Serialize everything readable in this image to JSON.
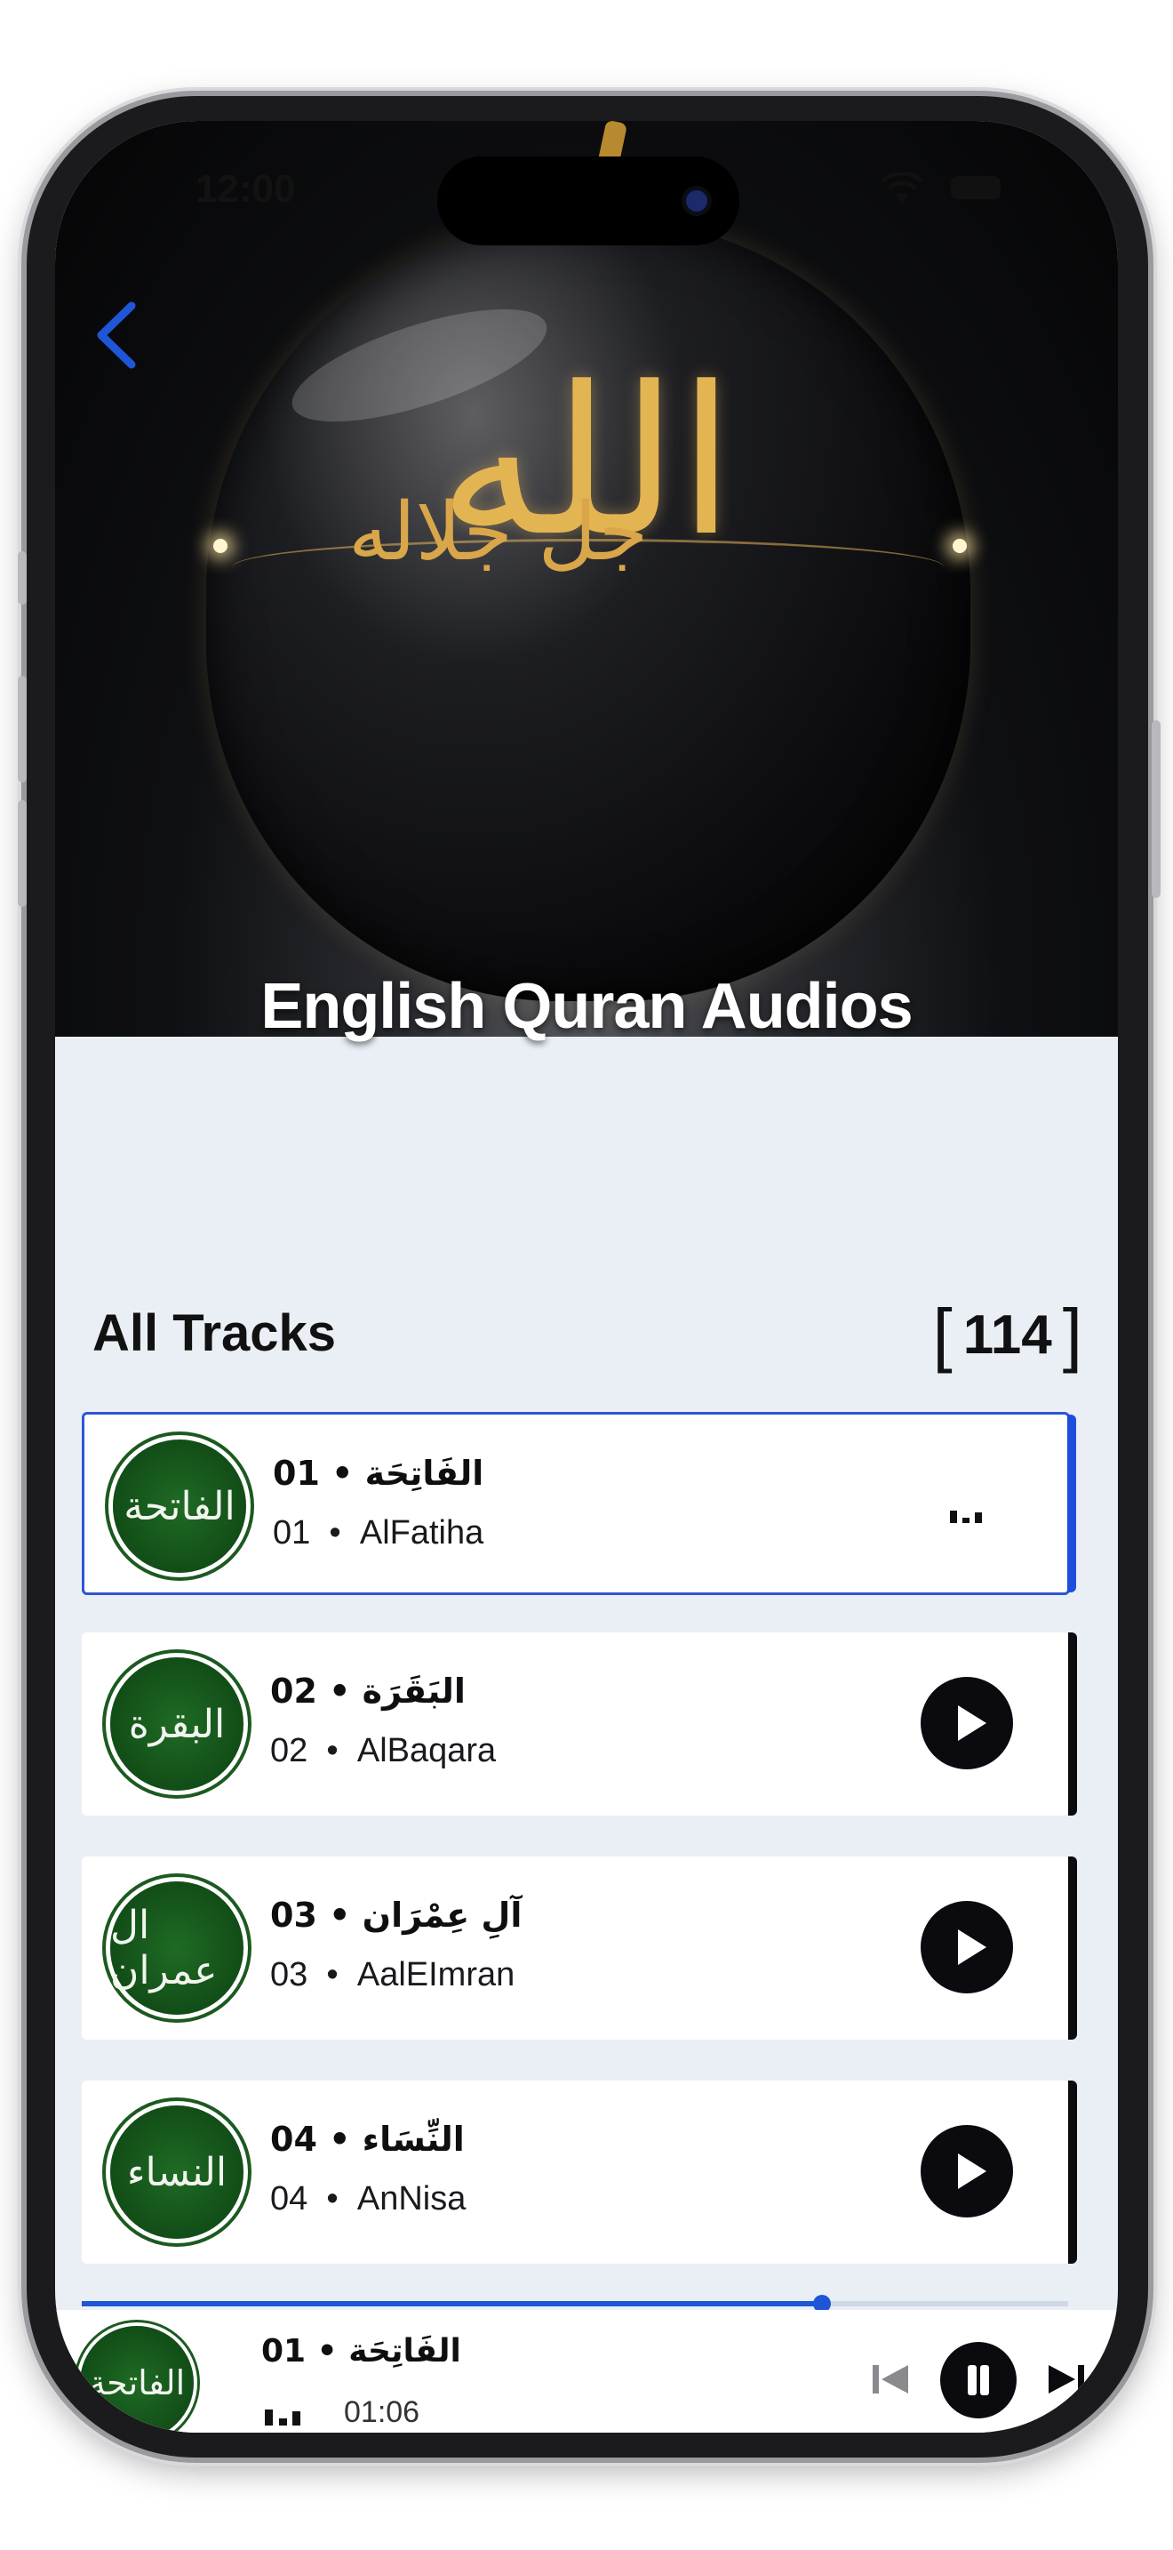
{
  "status_bar": {
    "time": "12:00"
  },
  "header": {
    "title": "English Quran Audios",
    "hero_calligraphy": "الله",
    "hero_calligraphy_2": "جل جلاله"
  },
  "tracks_section": {
    "title": "All Tracks",
    "count": "114"
  },
  "tracks": [
    {
      "arabic": "الفَاتِحَة",
      "number_bold": "01",
      "number": "01",
      "name": "AlFatiha",
      "badge_text": "الفاتحة",
      "state": "playing"
    },
    {
      "arabic": "البَقَرَة",
      "number_bold": "02",
      "number": "02",
      "name": "AlBaqara",
      "badge_text": "البقرة",
      "state": "idle"
    },
    {
      "arabic": "آلِ عِمْرَان",
      "number_bold": "03",
      "number": "03",
      "name": "AalEImran",
      "badge_text": "ال عمران",
      "state": "idle"
    },
    {
      "arabic": "النِّسَاء",
      "number_bold": "04",
      "number": "04",
      "name": "AnNisa",
      "badge_text": "النساء",
      "state": "idle"
    }
  ],
  "separator": "•",
  "player": {
    "title_number": "01",
    "title_arabic": "الفَاتِحَة",
    "badge_text": "الفاتحة",
    "elapsed": "01:06",
    "progress": 0.75
  },
  "colors": {
    "accent": "#1f56d8",
    "badge_green": "#124d17",
    "background": "#eaeff6",
    "dark": "#0a0a0f"
  }
}
